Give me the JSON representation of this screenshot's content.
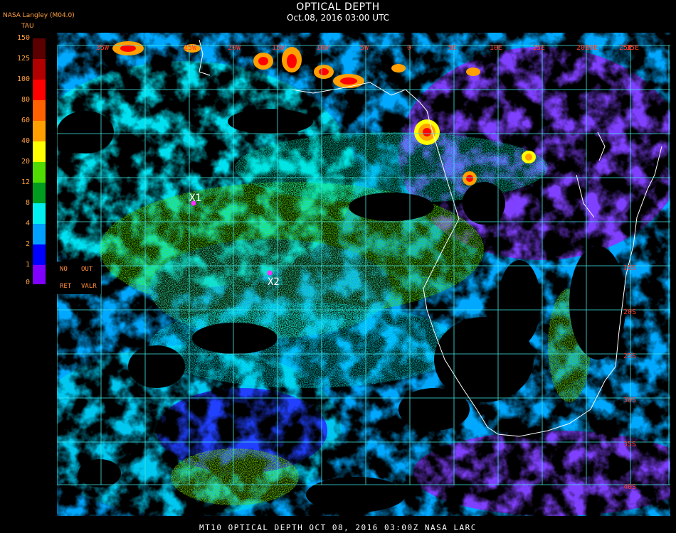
{
  "header": {
    "title": "OPTICAL DEPTH",
    "subtitle": "Oct.08, 2016 03:00 UTC",
    "producer": "NASA Langley (M04.0)"
  },
  "legend": {
    "unit": "TAU",
    "ticks": [
      "150",
      "125",
      "100",
      "80",
      "60",
      "40",
      "20",
      "12",
      "8",
      "4",
      "2",
      "1",
      "0"
    ],
    "colors": [
      "#5a0000",
      "#b00000",
      "#ff0000",
      "#ff6000",
      "#ffa000",
      "#ffff00",
      "#50dc00",
      "#009c20",
      "#00f0f0",
      "#00a0ff",
      "#0000ff",
      "#8000ff"
    ],
    "no_retrieval": {
      "line1_a": "NO",
      "line1_b": "OUT",
      "line2_a": "RET",
      "line2_b": "VALR"
    }
  },
  "grid": {
    "lon_labels": [
      "35W",
      "25W",
      "20W",
      "15W",
      "10W",
      "5W",
      "0",
      "5E",
      "10E",
      "15E",
      "20E",
      "25E",
      "30E",
      "35E"
    ],
    "lat_labels": [
      "15S",
      "20S",
      "25S",
      "30S",
      "35S",
      "40S"
    ],
    "line_color": "#40e8e8",
    "label_color": "#ff3a2a"
  },
  "markers": [
    {
      "id": "X1",
      "color": "#ff30ff"
    },
    {
      "id": "X2",
      "color": "#ff30ff"
    }
  ],
  "footer": {
    "text": "MT10   OPTICAL DEPTH   OCT 08, 2016 03:00Z   NASA LARC"
  }
}
